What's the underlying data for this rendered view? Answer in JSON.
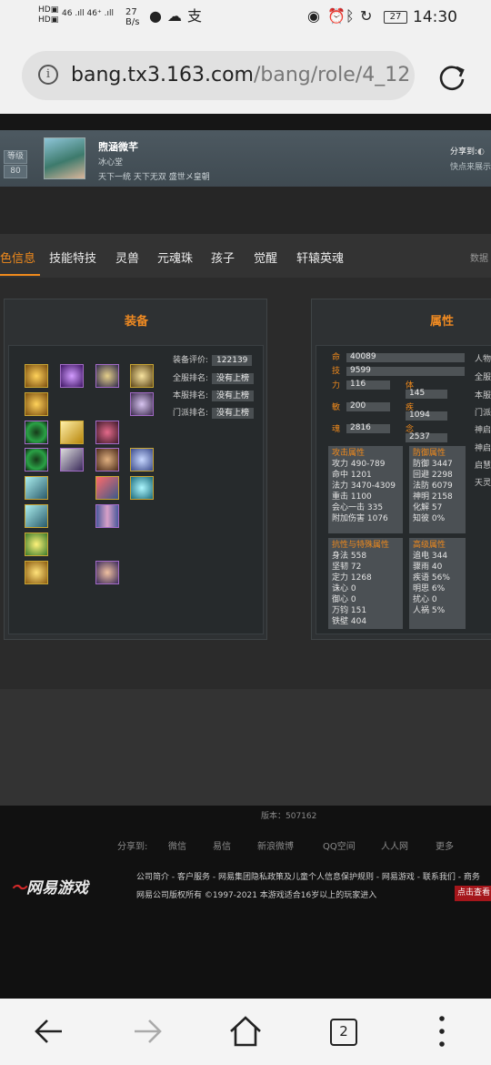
{
  "status_bar": {
    "hd": "HD",
    "signal": "46 .ıll 46⁺ .ıll",
    "speed_value": "27",
    "speed_unit": "B/s",
    "battery": "27",
    "time": "14:30"
  },
  "address_bar": {
    "host": "bang.tx3.163.com",
    "path": "/bang/role/4_12"
  },
  "profile": {
    "level_label": "等级",
    "level_value": "80",
    "name": "煦涵微芊",
    "guild": "冰心堂",
    "server": "天下一统 天下无双 盛世メ皇朝",
    "share_label": "分享到:",
    "share_sub": "快点来展示"
  },
  "tabs": [
    "色信息",
    "技能特技",
    "灵兽",
    "元魂珠",
    "孩子",
    "觉醒",
    "轩辕英魂"
  ],
  "tab_right": "数据",
  "equipment": {
    "title": "装备",
    "rows": [
      {
        "label": "装备评价:",
        "value": "122139"
      },
      {
        "label": "全服排名:",
        "value": "没有上榜"
      },
      {
        "label": "本服排名:",
        "value": "没有上榜"
      },
      {
        "label": "门派排名:",
        "value": "没有上榜"
      }
    ]
  },
  "attributes": {
    "title": "属性",
    "ming_k": "命",
    "ming_v": "40089",
    "ji_k": "技",
    "ji_v": "9599",
    "li_k": "力",
    "li_v": "116",
    "ti_k": "体",
    "ti_v": "145",
    "min_k": "敏",
    "min_v": "200",
    "ji2_k": "疾",
    "ji2_v": "1094",
    "hun_k": "魂",
    "hun_v": "2816",
    "nian_k": "念",
    "nian_v": "2537",
    "attack": {
      "title": "攻击属性",
      "rows": [
        "攻力 490-789",
        "命中 1201",
        "法力 3470-4309",
        "重击 1100",
        "会心一击 335",
        "附加伤害 1076"
      ]
    },
    "defense": {
      "title": "防御属性",
      "rows": [
        "防御 3447",
        "回避 2298",
        "法防 6079",
        "神明 2158",
        "化解 57",
        "知彼 0%"
      ]
    },
    "resist": {
      "title": "抗性与特殊属性",
      "rows": [
        "身法 558",
        "坚韧 72",
        "定力 1268",
        "诛心 0",
        "御心 0",
        "万钧 151",
        "铁壁 404"
      ]
    },
    "advanced": {
      "title": "高级属性",
      "rows": [
        "追电 344",
        "骤雨 40",
        "疾语 56%",
        "明思 6%",
        "扰心 0",
        "人祸 5%"
      ]
    },
    "side": [
      "人物",
      "全服",
      "本服",
      "门派",
      "神启",
      "神启",
      "启慧",
      "天灵"
    ]
  },
  "footer": {
    "version": "版本：507162",
    "share": [
      "分享到:",
      "微信",
      "易信",
      "新浪微博",
      "QQ空间",
      "人人网",
      "更多"
    ],
    "logo_mark": "〜",
    "logo_text": "网易游戏",
    "links": "公司简介 - 客户服务 - 网易集团隐私政策及儿童个人信息保护规则 - 网易游戏 - 联系我们 - 商务",
    "copyright": "网易公司版权所有 ©1997-2021    本游戏适合16岁以上的玩家进入",
    "button": "点击查看"
  },
  "nav": {
    "tab_count": "2"
  },
  "colors": {
    "accent": "#f08a1c",
    "panel": "#2e3133",
    "footer_btn": "#a5161b"
  }
}
